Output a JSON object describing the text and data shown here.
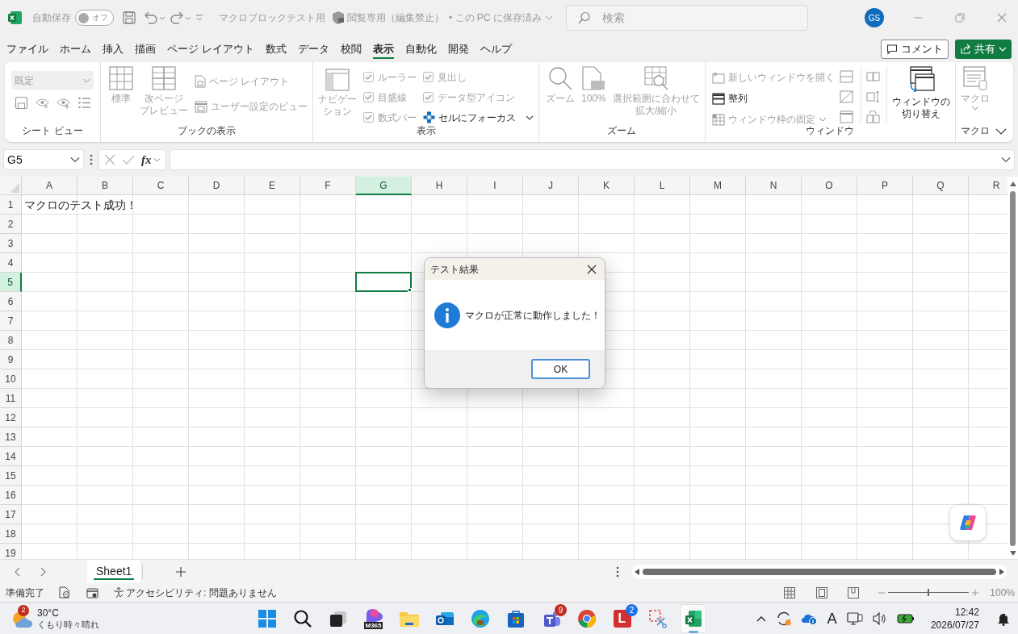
{
  "title_bar": {
    "autosave_label": "自動保存",
    "autosave_toggle": {
      "label": "オフ",
      "on": false
    },
    "file_name": "マクロブロックテスト用",
    "protection": "閲覧専用（編集禁止）",
    "save_status": "• この PC に保存済み",
    "search": {
      "placeholder": "検索"
    },
    "avatar": "GS"
  },
  "menu_tabs": [
    {
      "label": "ファイル",
      "selected": false
    },
    {
      "label": "ホーム",
      "selected": false
    },
    {
      "label": "挿入",
      "selected": false
    },
    {
      "label": "描画",
      "selected": false
    },
    {
      "label": "ページ レイアウト",
      "selected": false
    },
    {
      "label": "数式",
      "selected": false
    },
    {
      "label": "データ",
      "selected": false
    },
    {
      "label": "校閲",
      "selected": false
    },
    {
      "label": "表示",
      "selected": true
    },
    {
      "label": "自動化",
      "selected": false
    },
    {
      "label": "開発",
      "selected": false
    },
    {
      "label": "ヘルプ",
      "selected": false
    }
  ],
  "comment_button": "コメント",
  "share_button": "共有",
  "ribbon": {
    "groups": [
      {
        "kind": "sheet_view",
        "label": "シート ビュー",
        "view_select": {
          "value": "既定",
          "disabled": true
        }
      },
      {
        "kind": "book_view",
        "label": "ブックの表示",
        "large": [
          {
            "lines": [
              "標準"
            ],
            "disabled": true
          },
          {
            "lines": [
              "改ページ",
              "プレビュー"
            ],
            "disabled": true
          }
        ],
        "small": [
          {
            "label": "ページ レイアウト",
            "disabled": true
          },
          {
            "label": "ユーザー設定のビュー",
            "disabled": true
          }
        ]
      },
      {
        "kind": "show",
        "label": "表示",
        "large": [
          {
            "lines": [
              "ナビゲー",
              "ション"
            ],
            "disabled": true
          }
        ],
        "checkboxes": [
          {
            "label": "ルーラー",
            "checked": true,
            "disabled": true
          },
          {
            "label": "目盛線",
            "checked": true,
            "disabled": true
          },
          {
            "label": "数式バー",
            "checked": true,
            "disabled": true
          },
          {
            "label": "見出し",
            "checked": true,
            "disabled": true
          },
          {
            "label": "データ型アイコン",
            "checked": true,
            "disabled": true
          }
        ],
        "focus": {
          "label": "セルにフォーカス",
          "disabled": false
        }
      },
      {
        "kind": "zoom",
        "label": "ズーム",
        "large": [
          {
            "lines": [
              "ズーム"
            ],
            "disabled": true
          },
          {
            "lines": [
              "100%"
            ],
            "disabled": true
          },
          {
            "lines": [
              "選択範囲に合わせて",
              "拡大/縮小"
            ],
            "disabled": true
          }
        ]
      },
      {
        "kind": "window",
        "label": "ウィンドウ",
        "small": [
          {
            "label": "新しいウィンドウを開く",
            "disabled": true
          },
          {
            "label": "整列",
            "disabled": false
          },
          {
            "label": "ウィンドウ枠の固定",
            "disabled": true
          }
        ],
        "switch": {
          "lines": [
            "ウィンドウの",
            "切り替え"
          ],
          "disabled": false
        }
      },
      {
        "kind": "macro",
        "label": "マクロ",
        "large": [
          {
            "lines": [
              "マクロ"
            ],
            "disabled": true
          }
        ]
      }
    ]
  },
  "formula_bar": {
    "name_box": "G5",
    "fx": "fx"
  },
  "columns": [
    {
      "label": "A",
      "selected": false
    },
    {
      "label": "B",
      "selected": false
    },
    {
      "label": "C",
      "selected": false
    },
    {
      "label": "D",
      "selected": false
    },
    {
      "label": "E",
      "selected": false
    },
    {
      "label": "F",
      "selected": false
    },
    {
      "label": "G",
      "selected": true
    },
    {
      "label": "H",
      "selected": false
    },
    {
      "label": "I",
      "selected": false
    },
    {
      "label": "J",
      "selected": false
    },
    {
      "label": "K",
      "selected": false
    },
    {
      "label": "L",
      "selected": false
    },
    {
      "label": "M",
      "selected": false
    },
    {
      "label": "N",
      "selected": false
    },
    {
      "label": "O",
      "selected": false
    },
    {
      "label": "P",
      "selected": false
    },
    {
      "label": "Q",
      "selected": false
    },
    {
      "label": "R",
      "selected": false
    }
  ],
  "rows": [
    {
      "label": "1",
      "selected": false,
      "cells": [
        "マクロのテスト成功！"
      ]
    },
    {
      "label": "2",
      "selected": false
    },
    {
      "label": "3",
      "selected": false
    },
    {
      "label": "4",
      "selected": false
    },
    {
      "label": "5",
      "selected": true
    },
    {
      "label": "6",
      "selected": false
    },
    {
      "label": "7",
      "selected": false
    },
    {
      "label": "8",
      "selected": false
    },
    {
      "label": "9",
      "selected": false
    },
    {
      "label": "10",
      "selected": false
    },
    {
      "label": "11",
      "selected": false
    },
    {
      "label": "12",
      "selected": false
    },
    {
      "label": "13",
      "selected": false
    },
    {
      "label": "14",
      "selected": false
    },
    {
      "label": "15",
      "selected": false
    },
    {
      "label": "16",
      "selected": false
    },
    {
      "label": "17",
      "selected": false
    },
    {
      "label": "18",
      "selected": false
    },
    {
      "label": "19",
      "selected": false
    }
  ],
  "dialog": {
    "title": "テスト結果",
    "message": "マクロが正常に動作しました！",
    "button": "OK"
  },
  "sheet_tabs": [
    {
      "label": "Sheet1",
      "selected": true
    }
  ],
  "status_bar": {
    "status": "準備完了",
    "accessibility": "アクセシビリティ: 問題ありません",
    "zoom": {
      "level": 0.5,
      "reading": "100%"
    }
  },
  "taskbar": {
    "weather": {
      "badge": "2",
      "temperature": "30°C",
      "condition": "くもり時々晴れ"
    },
    "apps": [
      {
        "kind": "start"
      },
      {
        "kind": "search"
      },
      {
        "kind": "taskview"
      },
      {
        "kind": "m365",
        "label": "M365"
      },
      {
        "kind": "explorer"
      },
      {
        "kind": "outlook"
      },
      {
        "kind": "edge"
      },
      {
        "kind": "store"
      },
      {
        "kind": "teams",
        "badge": "9"
      },
      {
        "kind": "chrome"
      },
      {
        "kind": "letter",
        "label": "L",
        "badge": "2"
      },
      {
        "kind": "snip"
      },
      {
        "kind": "excel",
        "active": true
      }
    ],
    "ime": "A",
    "time": "12:42",
    "date": "2026/07/27"
  }
}
